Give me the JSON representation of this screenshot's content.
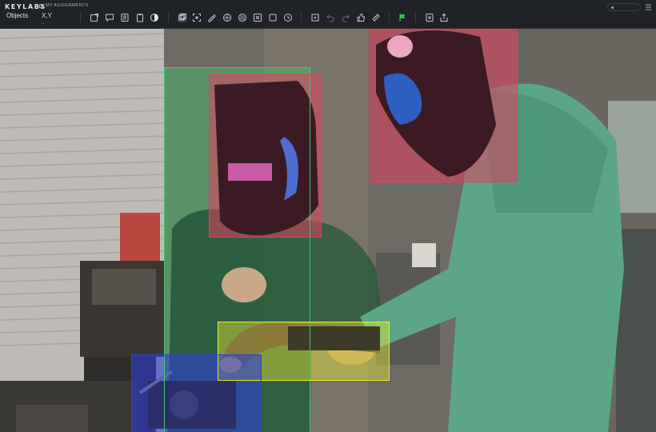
{
  "app": {
    "brand": "KEYLABS",
    "assignments": "MY ASSIGNMENTS"
  },
  "panel": {
    "tab_objects": "Objects",
    "tab_xy": "X,Y",
    "tab_xy_mark": "-"
  },
  "toolbar": {
    "icons": [
      "new-label-icon",
      "comment-icon",
      "list-icon",
      "clipboard-icon",
      "contrast-icon",
      "layers-icon",
      "expand-icon",
      "paint-icon",
      "grid-icon",
      "image-adjust-icon",
      "square-icon",
      "timer-icon",
      "box-select-icon",
      "undo-icon",
      "redo-icon",
      "like-icon",
      "ruler-icon",
      "flag-icon",
      "clear-icon",
      "export-icon"
    ],
    "accent": "#33c24d"
  },
  "annotations": {
    "person_color": "#3ec96b",
    "helmet_color": "#e2405c",
    "tool_color": "#e6e83a",
    "vise_color": "#2f3fd6",
    "boxes": [
      {
        "name": "person-left-bbox",
        "class": "person",
        "color": "#3ec96b"
      },
      {
        "name": "helmet-left-bbox",
        "class": "helmet",
        "color": "#e2405c"
      },
      {
        "name": "helmet-right-bbox",
        "class": "helmet",
        "color": "#e2405c"
      },
      {
        "name": "welding-torch-bbox",
        "class": "tool",
        "color": "#e6e83a"
      },
      {
        "name": "bench-vise-bbox",
        "class": "vise",
        "color": "#2f3fd6"
      }
    ]
  }
}
